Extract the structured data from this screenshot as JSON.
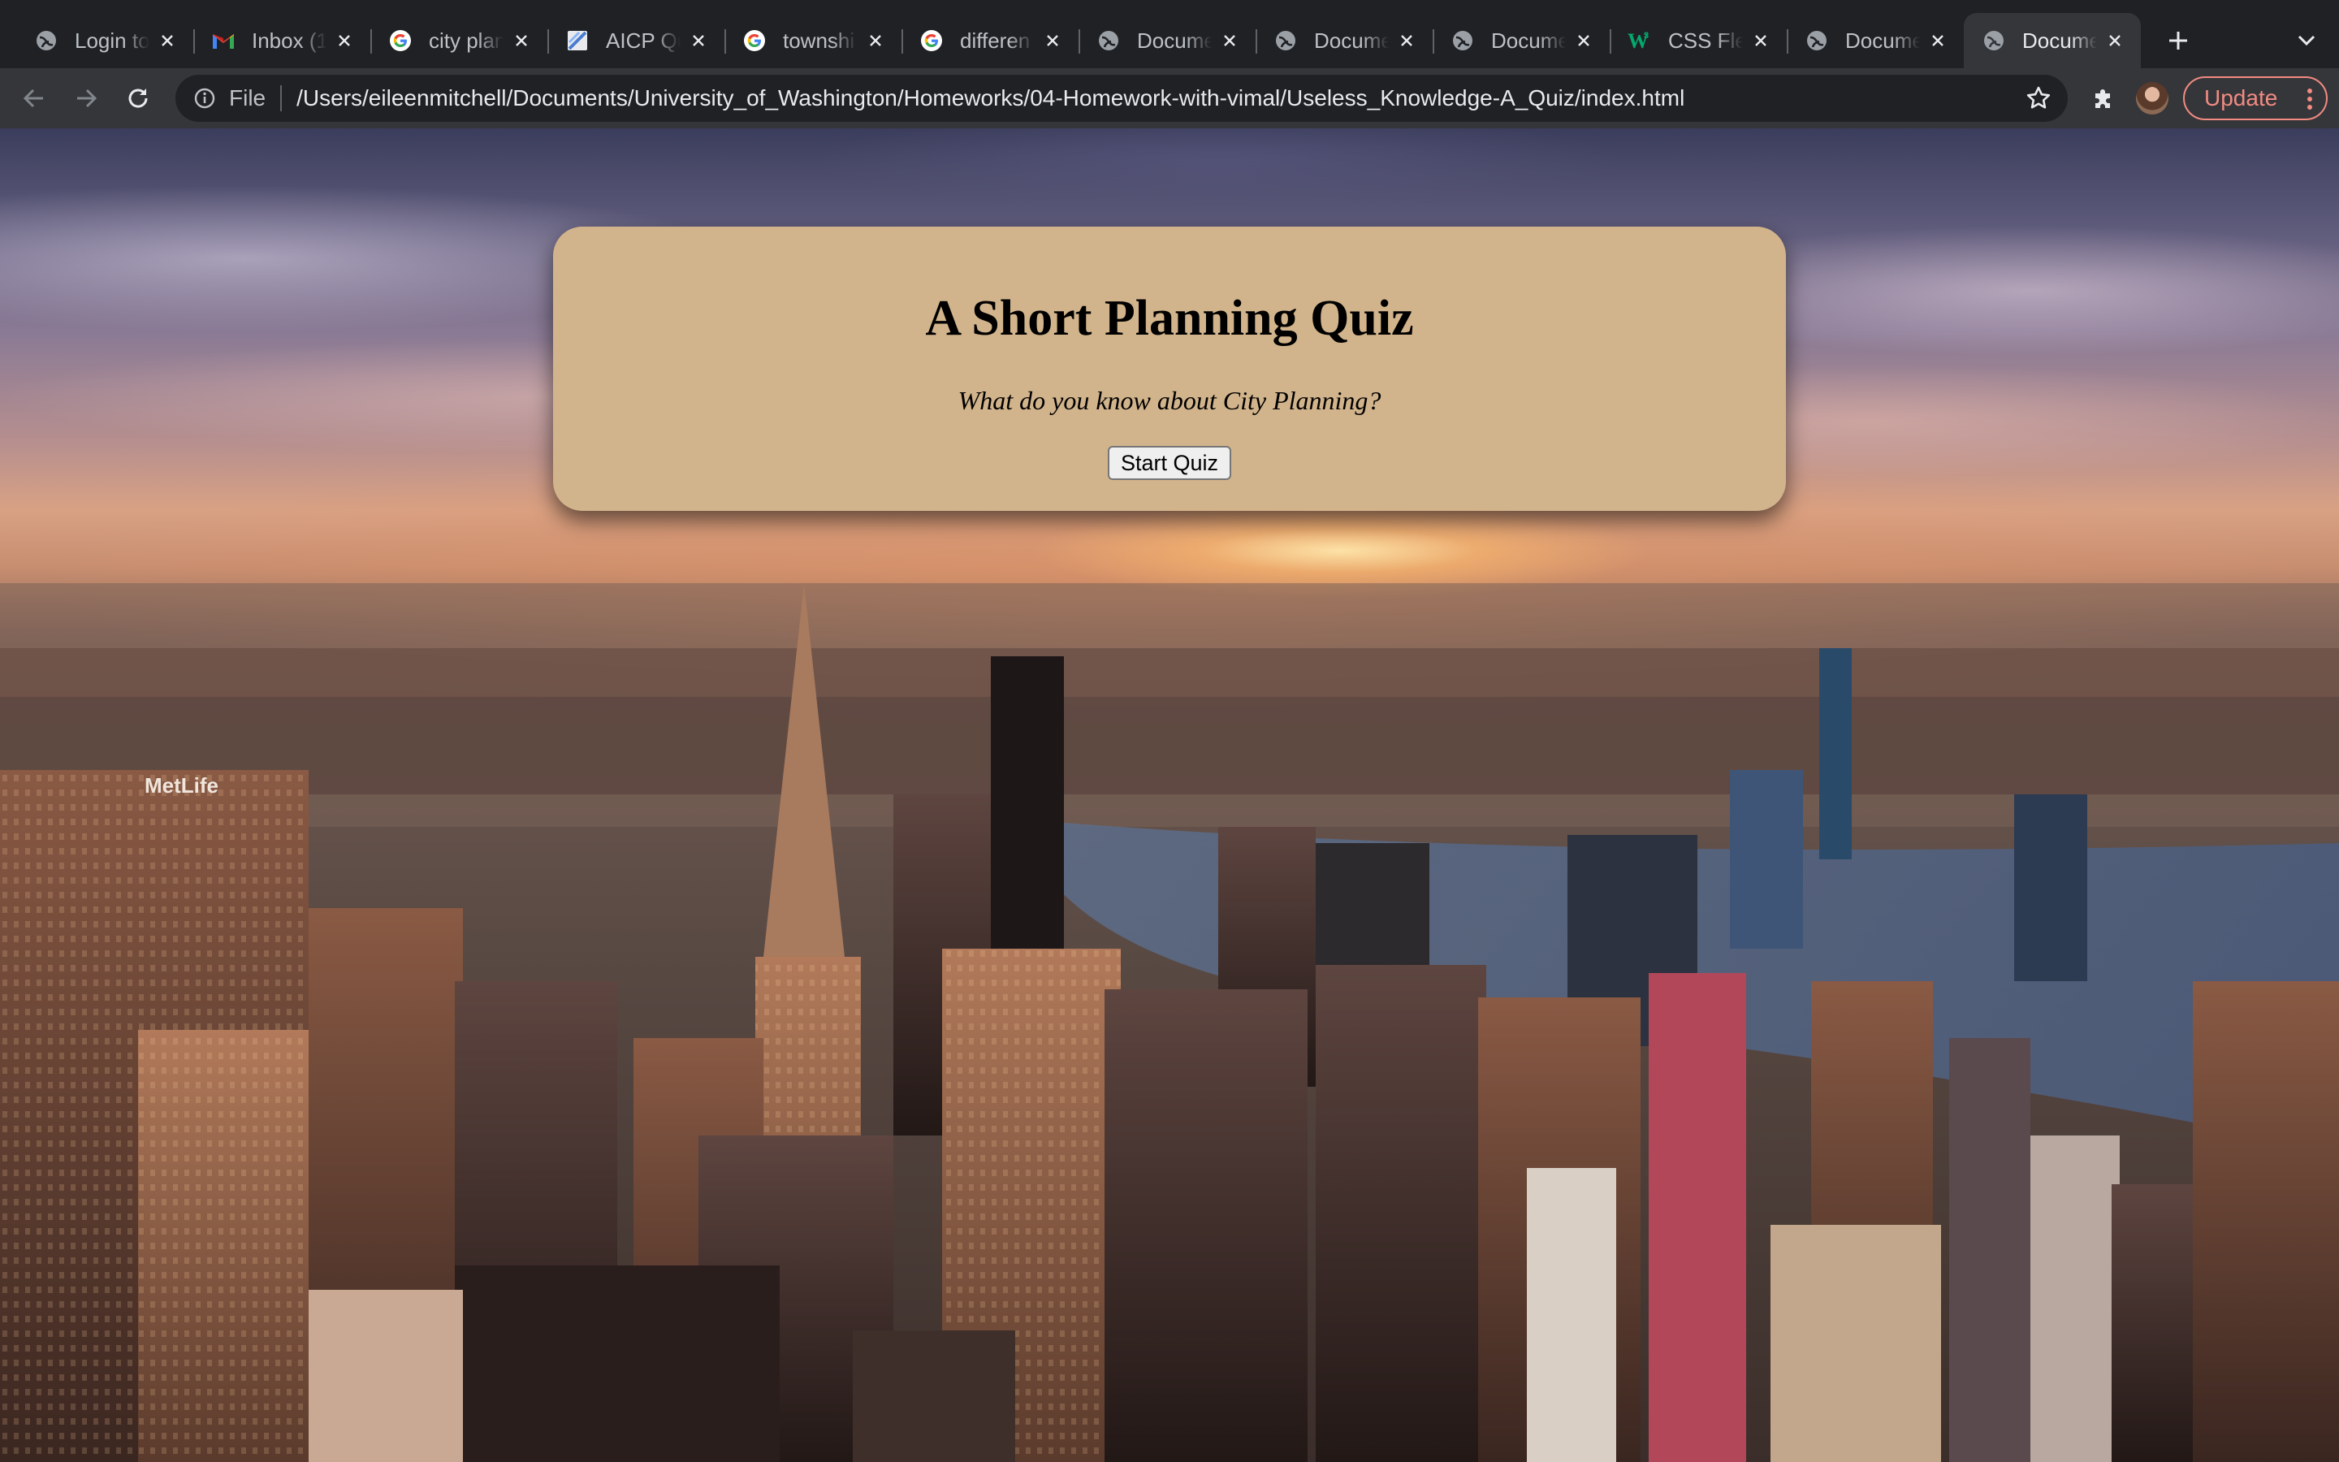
{
  "browser": {
    "tabs": [
      {
        "title": "Login to",
        "icon": "globe-icon",
        "active": false
      },
      {
        "title": "Inbox (1",
        "icon": "gmail-icon",
        "active": false
      },
      {
        "title": "city plan",
        "icon": "google-icon",
        "active": false
      },
      {
        "title": "AICP Qu",
        "icon": "page-icon",
        "active": false
      },
      {
        "title": "townshi",
        "icon": "google-icon",
        "active": false
      },
      {
        "title": "differen",
        "icon": "google-icon",
        "active": false
      },
      {
        "title": "Docume",
        "icon": "globe-icon",
        "active": false
      },
      {
        "title": "Docume",
        "icon": "globe-icon",
        "active": false
      },
      {
        "title": "Docume",
        "icon": "globe-icon",
        "active": false
      },
      {
        "title": "CSS Fle",
        "icon": "w3schools-icon",
        "active": false
      },
      {
        "title": "Docume",
        "icon": "globe-icon",
        "active": false
      },
      {
        "title": "Docume",
        "icon": "globe-icon",
        "active": true
      }
    ],
    "address_bar": {
      "scheme_label": "File",
      "url": "/Users/eileenmitchell/Documents/University_of_Washington/Homeworks/04-Homework-with-vimal/Useless_Knowledge-A_Quiz/index.html"
    },
    "update_label": "Update"
  },
  "quiz": {
    "title": "A Short Planning Quiz",
    "subtitle": "What do you know about City Planning?",
    "start_button": "Start Quiz"
  },
  "colors": {
    "card_background": "#d2b48c",
    "chrome_dark": "#202124",
    "chrome_toolbar": "#35363a",
    "update_accent": "#f28b82"
  }
}
